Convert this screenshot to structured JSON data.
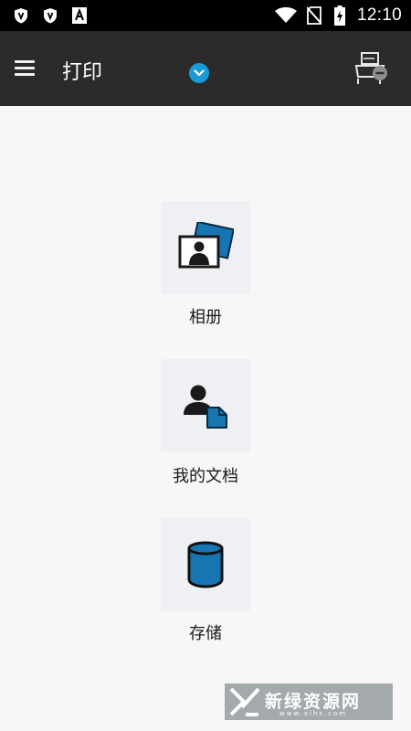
{
  "status_bar": {
    "time": "12:10",
    "icons": [
      "shield-icon",
      "shield-icon",
      "font-icon",
      "wifi-icon",
      "no-sim-icon",
      "battery-charging-icon"
    ]
  },
  "app_bar": {
    "title": "打印",
    "menu_icon": "menu-icon",
    "dropdown_icon": "chevron-down-icon",
    "printer_icon": "printer-icon",
    "accent_color": "#1a9ad6",
    "background_color": "#2b2b2b"
  },
  "tiles": [
    {
      "label": "相册",
      "icon": "photo-album-icon"
    },
    {
      "label": "我的文档",
      "icon": "my-documents-icon"
    },
    {
      "label": "存储",
      "icon": "storage-icon"
    }
  ],
  "watermark": {
    "text": "新绿资源网",
    "sub": "www.xlhs.com"
  }
}
